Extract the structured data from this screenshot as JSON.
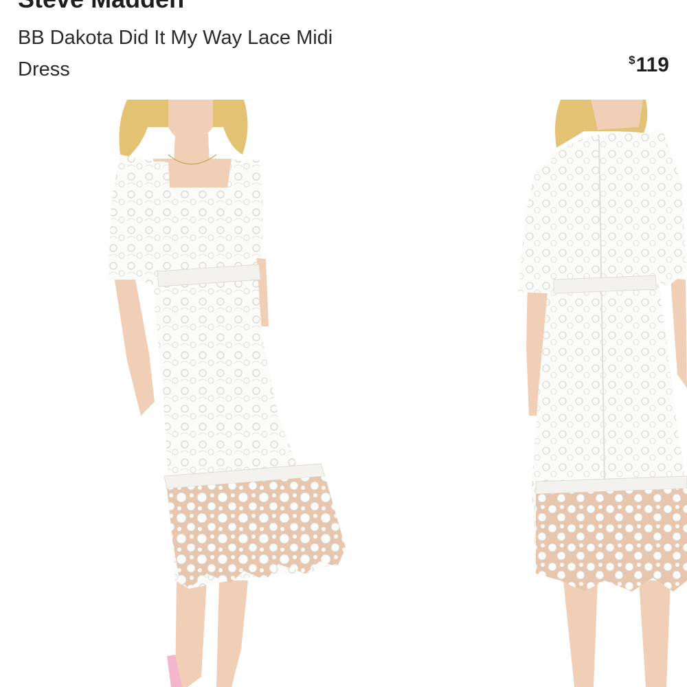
{
  "product": {
    "brand": "Steve Madden",
    "name": "BB Dakota Did It My Way Lace Midi Dress",
    "price_symbol": "$",
    "price_amount": "119"
  },
  "gallery": {
    "images": [
      {
        "view": "front",
        "icon": "dress-front-photo"
      },
      {
        "view": "back",
        "icon": "dress-back-photo"
      }
    ]
  },
  "colors": {
    "dress": "#fbfbf9",
    "lace_shadow": "#e4e2de",
    "skin": "#f0cfb6",
    "hair": "#e4c274",
    "shoe": "#f3b6cd"
  }
}
